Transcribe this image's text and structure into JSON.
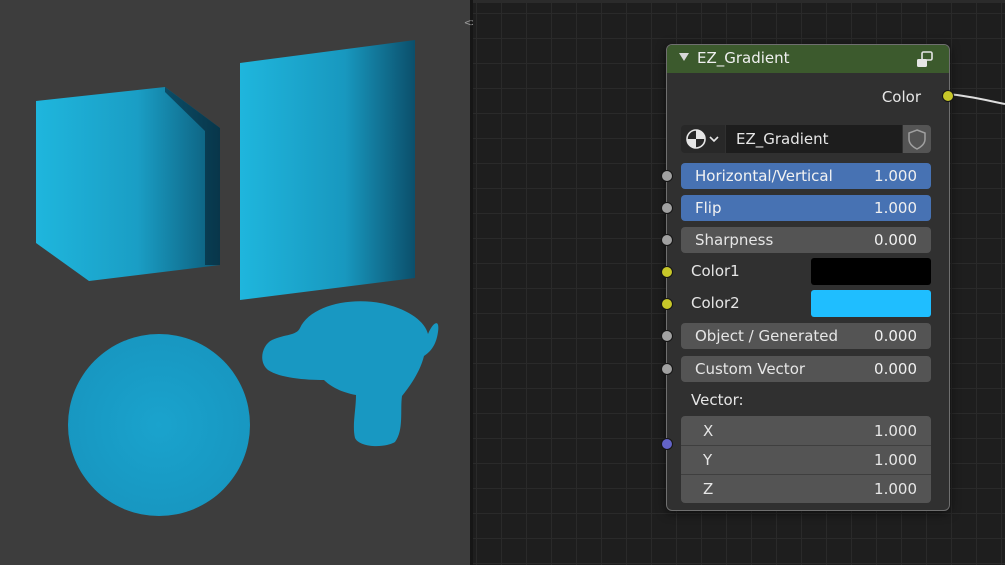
{
  "viewport": {
    "object_color": "#1fb2db",
    "shadow_color": "#0a4d66",
    "background_color": "#3d3d3d",
    "objects": [
      "cube",
      "plane",
      "sphere",
      "monkey"
    ]
  },
  "splitter": {
    "handle_glyph": "<>"
  },
  "node": {
    "title": "EZ_Gradient",
    "header_color": "#3c5a2d",
    "output": {
      "label": "Color",
      "socket_color": "#c7c729"
    },
    "group_selector": {
      "name": "EZ_Gradient"
    },
    "inputs": [
      {
        "label": "Horizontal/Vertical",
        "value": "1.000",
        "style": "blue",
        "socket": "grey"
      },
      {
        "label": "Flip",
        "value": "1.000",
        "style": "blue",
        "socket": "grey"
      },
      {
        "label": "Sharpness",
        "value": "0.000",
        "style": "grey",
        "socket": "grey"
      }
    ],
    "colors": [
      {
        "label": "Color1",
        "swatch": "#000000",
        "socket": "yellow"
      },
      {
        "label": "Color2",
        "swatch": "#1fbeff",
        "socket": "yellow"
      }
    ],
    "inputs2": [
      {
        "label": "Object / Generated",
        "value": "0.000",
        "style": "grey",
        "socket": "grey"
      },
      {
        "label": "Custom Vector",
        "value": "0.000",
        "style": "grey",
        "socket": "grey"
      }
    ],
    "vector": {
      "label": "Vector:",
      "components": [
        {
          "axis": "X",
          "value": "1.000"
        },
        {
          "axis": "Y",
          "value": "1.000"
        },
        {
          "axis": "Z",
          "value": "1.000"
        }
      ]
    }
  }
}
